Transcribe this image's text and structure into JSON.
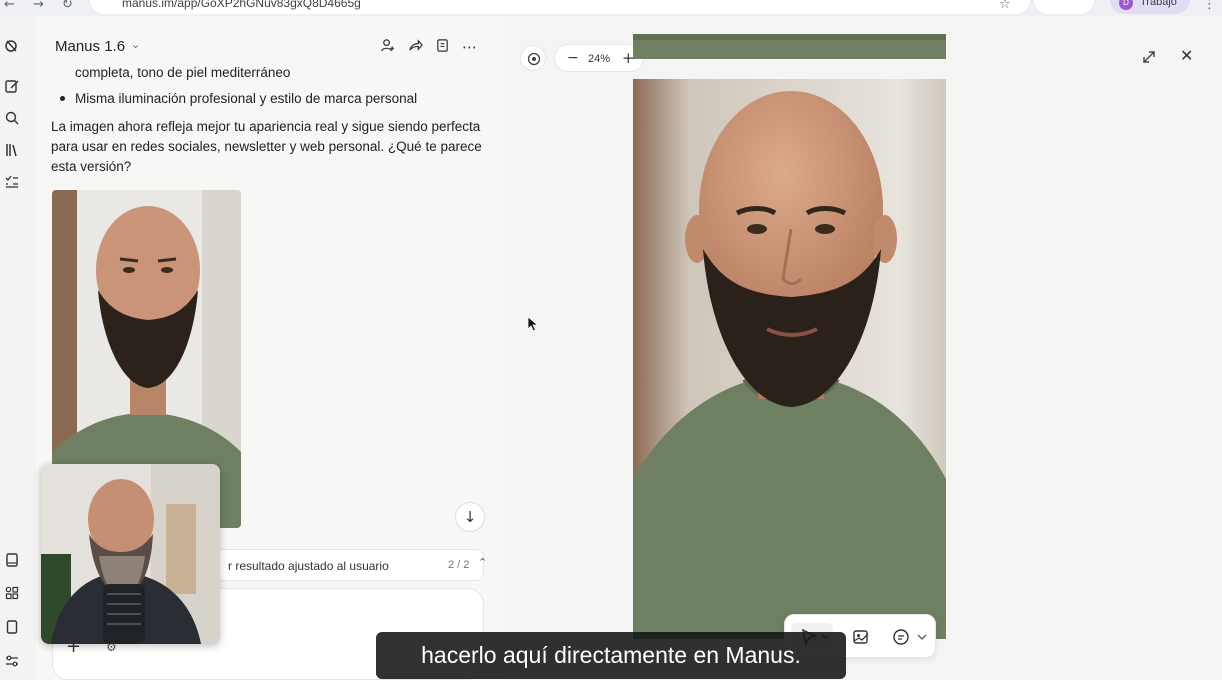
{
  "browser": {
    "url": "manus.im/app/GoXP2hGNuv83gxQ8D4665g",
    "profile_initial": "D",
    "profile_name": "Trabajo"
  },
  "rail": {
    "icons": [
      "manus-logo-icon",
      "new-task-icon",
      "search-icon",
      "library-icon",
      "tasks-list-icon",
      "book-icon",
      "apps-icon",
      "tablet-icon",
      "settings-icon"
    ]
  },
  "chat": {
    "title": "Manus 1.6",
    "bullet_continuation": "completa, tono de piel mediterráneo",
    "bullet_item": "Misma iluminación profesional y estilo de marca personal",
    "paragraph": "La imagen ahora refleja mejor tu apariencia real y sigue siendo perfecta para usar en redes sociales, newsletter y web personal. ¿Qué te parece esta versión?",
    "task_label": "r resultado ajustado al usuario",
    "task_count": "2 / 2"
  },
  "viewer": {
    "zoom": "24%"
  },
  "subtitle": "hacerlo aquí directamente en Manus.",
  "colors": {
    "accent_profile": "#9b59d0",
    "sweater": "#6e7f62",
    "skin": "#c99478"
  }
}
